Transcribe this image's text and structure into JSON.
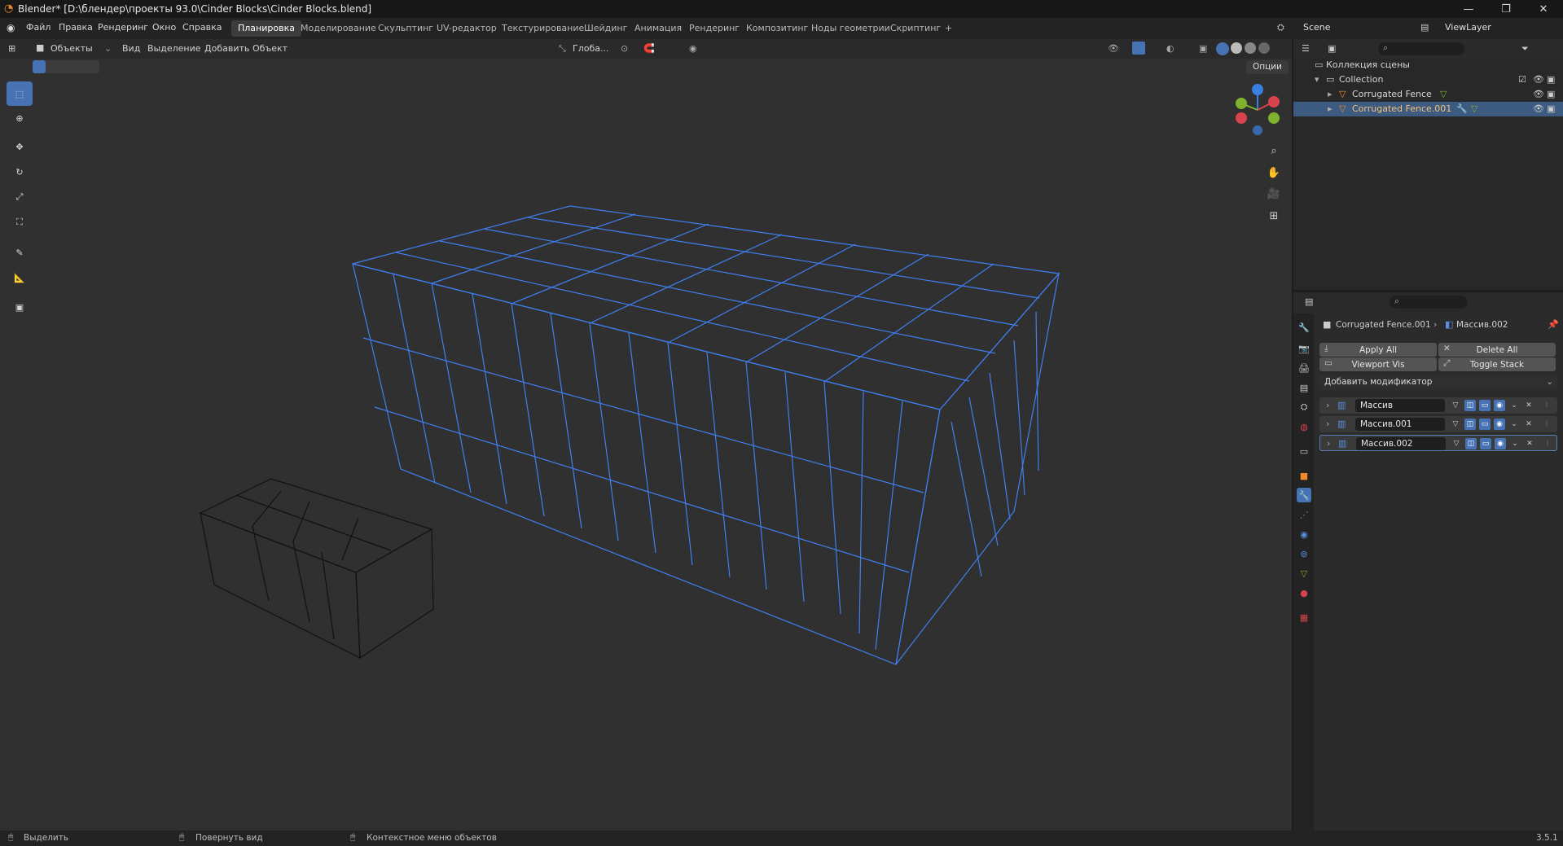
{
  "window": {
    "title": "Blender* [D:\\блендер\\проекты 93.0\\Cinder Blocks\\Cinder Blocks.blend]",
    "minimize": "—",
    "maximize": "❐",
    "close": "✕"
  },
  "menu": [
    "Файл",
    "Правка",
    "Рендеринг",
    "Окно",
    "Справка"
  ],
  "workspaces": [
    "Планировка",
    "Моделирование",
    "Скульптинг",
    "UV-редактор",
    "Текстурирование",
    "Шейдинг",
    "Анимация",
    "Рендеринг",
    "Композитинг",
    "Ноды геометрии",
    "Скриптинг"
  ],
  "workspace_add": "+",
  "scene": {
    "label": "Scene",
    "viewlayer": "ViewLayer"
  },
  "viewport_header": {
    "mode": "Объекты",
    "menus": [
      "Вид",
      "Выделение",
      "Добавить",
      "Объект"
    ],
    "orientation": "Глоба...",
    "options": "Опции"
  },
  "outliner": {
    "root": "Коллекция сцены",
    "collection": "Collection",
    "items": [
      {
        "name": "Corrugated Fence",
        "selected": false
      },
      {
        "name": "Corrugated Fence.001",
        "selected": true
      }
    ]
  },
  "properties": {
    "breadcrumb_object": "Corrugated Fence.001",
    "breadcrumb_modifier": "Массив.002",
    "apply_all": "Apply All",
    "delete_all": "Delete All",
    "viewport_vis": "Viewport Vis",
    "toggle_stack": "Toggle Stack",
    "add_modifier": "Добавить модификатор",
    "modifiers": [
      "Массив",
      "Массив.001",
      "Массив.002"
    ]
  },
  "statusbar": {
    "select": "Выделить",
    "rotate": "Повернуть вид",
    "context": "Контекстное меню объектов",
    "version": "3.5.1"
  },
  "colors": {
    "accent": "#4772b3",
    "selected_wire": "#3f7ff0",
    "axis_x": "#d9434e",
    "axis_y": "#7fb32e",
    "axis_z": "#3a80e0"
  }
}
